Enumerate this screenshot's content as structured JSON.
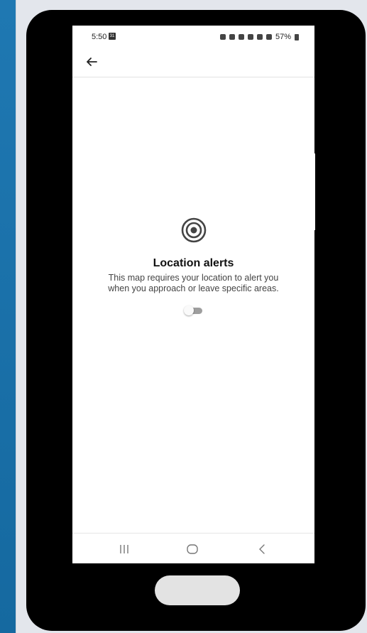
{
  "status_bar": {
    "time": "5:50",
    "calendar_badge": "31",
    "battery_percent": "57%"
  },
  "app_bar": {
    "back_icon": "arrow-left-icon"
  },
  "location_alerts": {
    "icon": "target-icon",
    "title": "Location alerts",
    "description": "This map requires your location to alert you when you approach or leave specific areas.",
    "toggle_on": false
  },
  "navigation": {
    "recents_icon": "recents-icon",
    "home_icon": "home-icon",
    "back_icon": "back-chevron-icon"
  },
  "colors": {
    "background_blue": "#1a6fa5",
    "phone_body": "#000000",
    "screen": "#ffffff",
    "toggle_track": "#9e9e9e"
  }
}
